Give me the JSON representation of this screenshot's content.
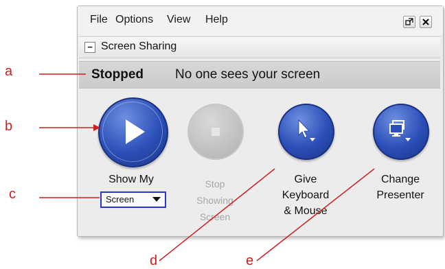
{
  "menubar": {
    "items": [
      "File",
      "Options",
      "View",
      "Help"
    ],
    "restore_icon": "restore-window-icon",
    "close_icon": "close-icon"
  },
  "section": {
    "collapse_symbol": "−",
    "title": "Screen Sharing"
  },
  "status": {
    "state": "Stopped",
    "message": "No one sees your screen"
  },
  "buttons": {
    "show": {
      "line1": "Show My",
      "select_value": "Screen",
      "icon": "play-icon"
    },
    "stop": {
      "lines": [
        "Stop",
        "Showing",
        "Screen"
      ],
      "icon": "stop-icon",
      "enabled": false
    },
    "keyboard": {
      "lines": [
        "Give",
        "Keyboard",
        "& Mouse"
      ],
      "icon": "cursor-dropdown-icon"
    },
    "presenter": {
      "lines": [
        "Change",
        "Presenter"
      ],
      "icon": "monitor-dropdown-icon"
    }
  },
  "callouts": [
    "a",
    "b",
    "c",
    "d",
    "e"
  ],
  "colors": {
    "accent_blue": "#2b4fb8",
    "callout_red": "#cc1f1f",
    "select_border": "#2836c9"
  }
}
